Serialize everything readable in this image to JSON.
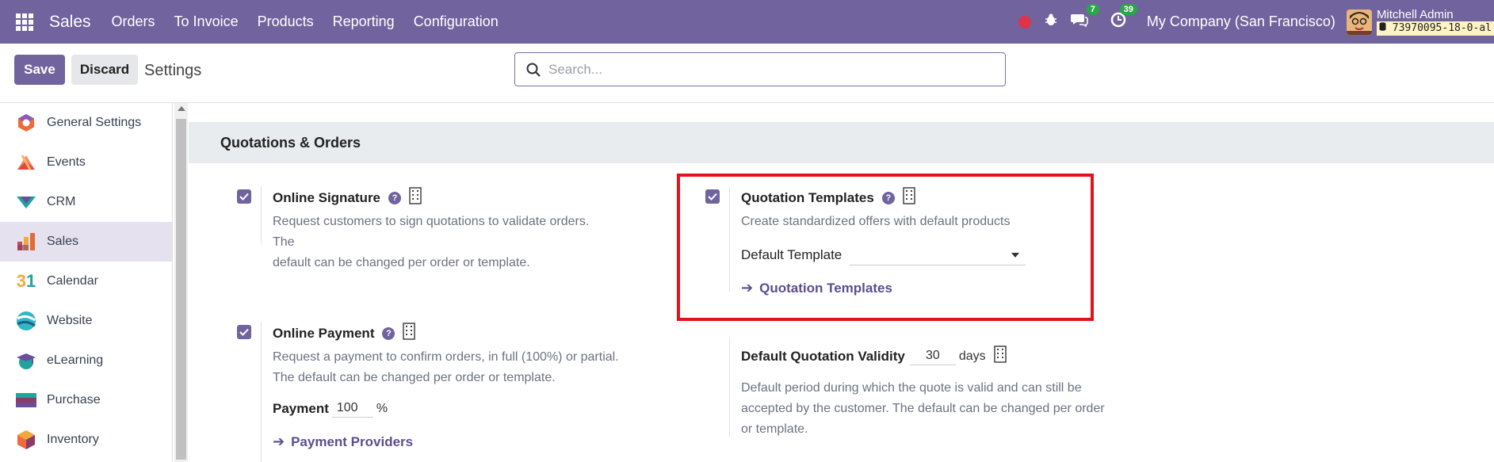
{
  "topbar": {
    "brand": "Sales",
    "menu": [
      "Orders",
      "To Invoice",
      "Products",
      "Reporting",
      "Configuration"
    ],
    "messages_badge": "7",
    "activities_badge": "39",
    "company": "My Company (San Francisco)",
    "user_name": "Mitchell Admin",
    "db_name": "73970095-18-0-al"
  },
  "controls": {
    "save_label": "Save",
    "discard_label": "Discard",
    "title": "Settings",
    "search_placeholder": "Search..."
  },
  "sidebar": {
    "items": [
      {
        "label": "General Settings",
        "icon": "general-settings-icon"
      },
      {
        "label": "Events",
        "icon": "events-icon"
      },
      {
        "label": "CRM",
        "icon": "crm-icon"
      },
      {
        "label": "Sales",
        "icon": "sales-icon",
        "active": true
      },
      {
        "label": "Calendar",
        "icon": "calendar-icon"
      },
      {
        "label": "Website",
        "icon": "website-icon"
      },
      {
        "label": "eLearning",
        "icon": "elearning-icon"
      },
      {
        "label": "Purchase",
        "icon": "purchase-icon"
      },
      {
        "label": "Inventory",
        "icon": "inventory-icon"
      }
    ]
  },
  "section": {
    "title": "Quotations & Orders",
    "online_signature": {
      "title": "Online Signature",
      "desc_line1": "Request customers to sign quotations to validate orders. The",
      "desc_line2": "default can be changed per order or template.",
      "checked": true
    },
    "quotation_templates": {
      "title": "Quotation Templates",
      "desc": "Create standardized offers with default products",
      "default_template_label": "Default Template",
      "default_template_value": "",
      "link": "Quotation Templates",
      "checked": true
    },
    "online_payment": {
      "title": "Online Payment",
      "desc_line1": "Request a payment to confirm orders, in full (100%) or partial.",
      "desc_line2": "The default can be changed per order or template.",
      "payment_label": "Payment",
      "payment_value": "100",
      "payment_unit": "%",
      "link": "Payment Providers",
      "checked": true
    },
    "quotation_validity": {
      "title": "Default Quotation Validity",
      "value": "30",
      "unit": "days",
      "desc_line1": "Default period during which the quote is valid and can still be",
      "desc_line2": "accepted by the customer. The default can be changed per order",
      "desc_line3": "or template."
    }
  },
  "colors": {
    "primary": "#71639e",
    "highlight": "#e0131b",
    "badge": "#28a745"
  }
}
